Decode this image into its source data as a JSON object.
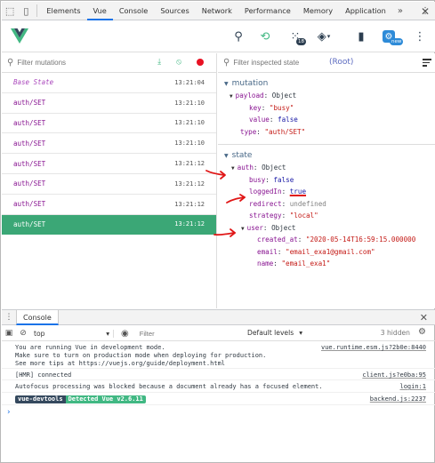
{
  "devtools": {
    "tabs": [
      "Elements",
      "Vue",
      "Console",
      "Sources",
      "Network",
      "Performance",
      "Memory",
      "Application"
    ],
    "active_tab": "Vue",
    "more": "»",
    "menu": "⋮",
    "close": "✕"
  },
  "vue_toolbar": {
    "vuex_badge": "18",
    "settings_badge": "new"
  },
  "mutations": {
    "filter_placeholder": "Filter mutations",
    "items": [
      {
        "name": "Base State",
        "time": "13:21:04"
      },
      {
        "name": "auth/SET",
        "time": "13:21:10"
      },
      {
        "name": "auth/SET",
        "time": "13:21:10"
      },
      {
        "name": "auth/SET",
        "time": "13:21:10"
      },
      {
        "name": "auth/SET",
        "time": "13:21:12"
      },
      {
        "name": "auth/SET",
        "time": "13:21:12"
      },
      {
        "name": "auth/SET",
        "time": "13:21:12"
      },
      {
        "name": "auth/SET",
        "time": "13:21:12"
      }
    ]
  },
  "inspector": {
    "filter_placeholder": "Filter inspected state",
    "root_label": "(Root)",
    "mutation_section": {
      "title": "mutation",
      "payload_key": "payload",
      "payload_type": "Object",
      "key_key": "key",
      "key_value": "\"busy\"",
      "value_key": "value",
      "value_value": "false",
      "type_key": "type",
      "type_value": "\"auth/SET\""
    },
    "state_section": {
      "title": "state",
      "auth_key": "auth",
      "auth_type": "Object",
      "busy_key": "busy",
      "busy_value": "false",
      "loggedin_key": "loggedIn",
      "loggedin_value": "true",
      "redirect_key": "redirect",
      "redirect_value": "undefined",
      "strategy_key": "strategy",
      "strategy_value": "\"local\"",
      "user_key": "user",
      "user_type": "Object",
      "created_key": "created_at",
      "created_value": "\"2020-05-14T16:59:15.000000",
      "email_key": "email",
      "email_value": "\"email_exa1@gmail.com\"",
      "name_key": "name",
      "name_value": "\"email_exa1\""
    }
  },
  "console": {
    "tab_label": "Console",
    "context": "top",
    "filter_placeholder": "Filter",
    "levels": "Default levels",
    "hidden": "3 hidden",
    "messages": [
      {
        "text": "You are running Vue in development mode.\nMake sure to turn on production mode when deploying for production.\nSee more tips at https://vuejs.org/guide/deployment.html",
        "source": "vue.runtime.esm.js?2b0e:8440"
      },
      {
        "text": "[HMR] connected",
        "source": "client.js?e0ba:95"
      },
      {
        "text": "Autofocus processing was blocked because a document already has a focused element.",
        "source": "login:1"
      },
      {
        "badge_left": "vue-devtools",
        "badge_right": "Detected Vue v2.6.11",
        "source": "backend.js:2237"
      }
    ],
    "prompt": "›"
  },
  "colors": {
    "vue_green": "#42b883",
    "selected_row": "#3ba776",
    "annotation_red": "#e01616",
    "accent_blue": "#1a73e8"
  }
}
